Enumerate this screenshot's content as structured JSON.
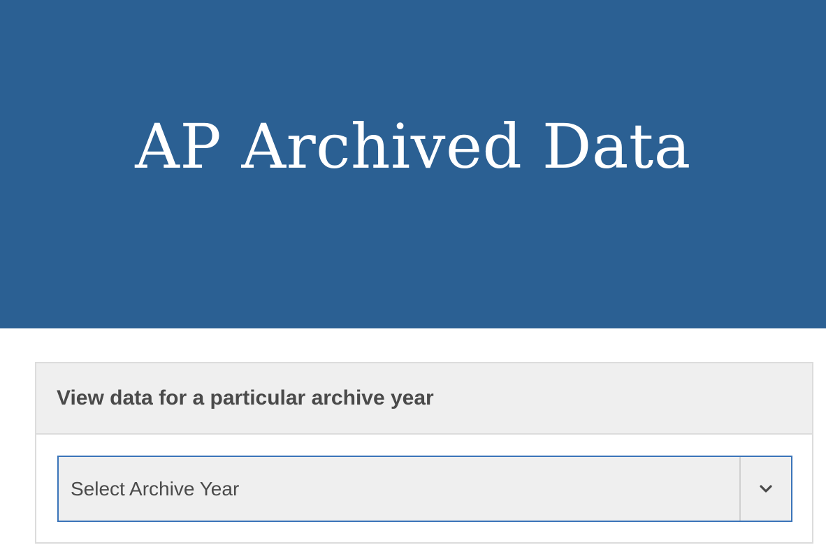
{
  "hero": {
    "title": "AP Archived Data",
    "background_color": "#2b6093"
  },
  "archive_panel": {
    "heading": "View data for a particular archive year",
    "select": {
      "selected_value": "Select Archive Year",
      "toggle_icon": "chevron-down-icon"
    }
  },
  "colors": {
    "accent_border": "#3a74b9",
    "panel_background": "#efefef",
    "text": "#4a4a4a"
  }
}
